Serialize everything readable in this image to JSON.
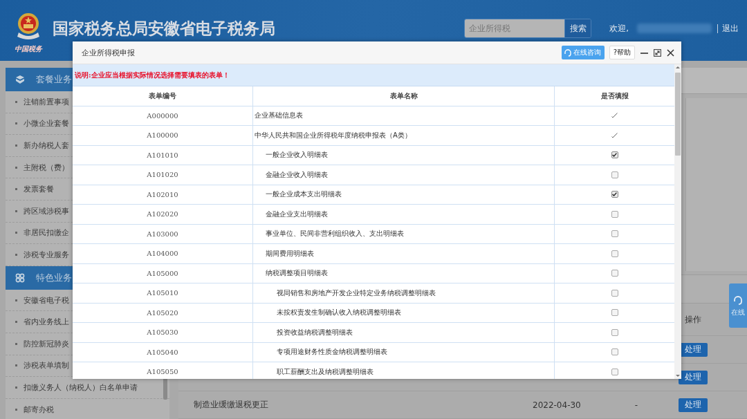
{
  "header": {
    "logo_text": "中国税务",
    "title": "国家税务总局安徽省电子税务局",
    "search": {
      "value": "企业所得税",
      "button": "搜索"
    },
    "welcome": "欢迎,",
    "logout": "退出"
  },
  "sidebar": {
    "sections": [
      {
        "title": "套餐业务",
        "items": [
          "注销前置事项",
          "小微企业套餐",
          "新办纳税人套",
          "主附税（费）",
          "发票套餐",
          "跨区域涉税事",
          "非居民扣缴企",
          "涉税专业服务"
        ]
      },
      {
        "title": "特色业务",
        "items": [
          "安徽省电子税",
          "省内业务线上",
          "防控新冠肺炎",
          "涉税表单填制",
          "扣缴义务人（纳税人）白名单申请",
          "邮寄办税"
        ]
      }
    ]
  },
  "main": {
    "column": "操作",
    "rows": [
      {
        "action": "处理"
      },
      {
        "action": "处理"
      },
      {
        "name": "制造业缓缴退税更正",
        "date": "2022-04-30",
        "status": "-",
        "action": "处理"
      }
    ],
    "chat_button": "在线"
  },
  "dialog": {
    "title": "企业所得税申报",
    "consult_button": "在线咨询",
    "help_button": "?帮助",
    "notice": "说明:企业应当根据实际情况选择需要填表的表单！",
    "columns": [
      "表单编号",
      "表单名称",
      "是否填报"
    ],
    "rows": [
      {
        "code": "A000000",
        "name": "企业基础信息表",
        "kind": "tick",
        "checked": true
      },
      {
        "code": "A100000",
        "name": "中华人民共和国企业所得税年度纳税申报表（A类）",
        "kind": "tick",
        "checked": true,
        "children": [
          {
            "code": "A101010",
            "name": "一般企业收入明细表",
            "kind": "checkbox",
            "checked": true
          },
          {
            "code": "A101020",
            "name": "金融企业收入明细表",
            "kind": "checkbox",
            "checked": false
          },
          {
            "code": "A102010",
            "name": "一般企业成本支出明细表",
            "kind": "checkbox",
            "checked": true
          },
          {
            "code": "A102020",
            "name": "金融企业支出明细表",
            "kind": "checkbox",
            "checked": false
          },
          {
            "code": "A103000",
            "name": "事业单位、民间非营利组织收入、支出明细表",
            "kind": "checkbox",
            "checked": false
          },
          {
            "code": "A104000",
            "name": "期间费用明细表",
            "kind": "checkbox",
            "checked": false
          },
          {
            "code": "A105000",
            "name": "纳税调整项目明细表",
            "kind": "checkbox",
            "checked": false,
            "children": [
              {
                "code": "A105010",
                "name": "视同销售和房地产开发企业特定业务纳税调整明细表",
                "kind": "checkbox",
                "checked": false
              },
              {
                "code": "A105020",
                "name": "未按权责发生制确认收入纳税调整明细表",
                "kind": "checkbox",
                "checked": false
              },
              {
                "code": "A105030",
                "name": "投资收益纳税调整明细表",
                "kind": "checkbox",
                "checked": false
              },
              {
                "code": "A105040",
                "name": "专项用途财务性质金纳税调整明细表",
                "kind": "checkbox",
                "checked": false
              },
              {
                "code": "A105050",
                "name": "职工薪酬支出及纳税调整明细表",
                "kind": "checkbox",
                "checked": false
              }
            ]
          }
        ]
      }
    ]
  }
}
